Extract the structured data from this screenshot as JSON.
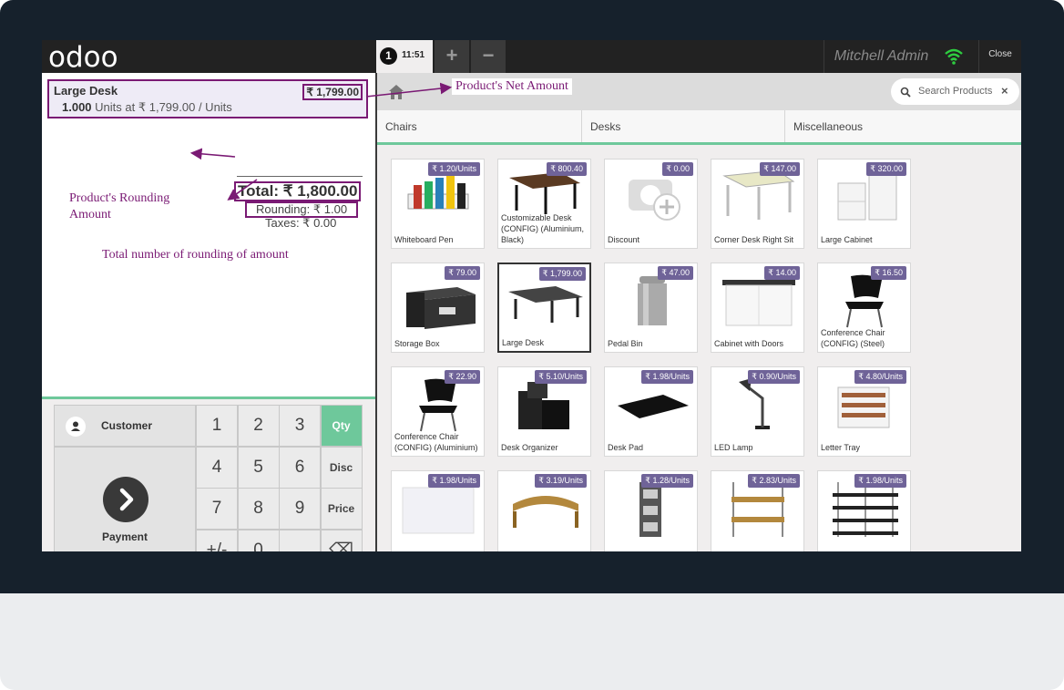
{
  "topbar": {
    "logo": "odoo",
    "order_number": "1",
    "order_time": "11:51",
    "add_label": "+",
    "remove_label": "−",
    "user": "Mitchell Admin",
    "close_label": "Close",
    "wifi_color": "#2ecc40"
  },
  "orderline": {
    "name": "Large Desk",
    "price": "₹ 1,799.00",
    "qty": "1.000",
    "unit_info": "Units at ₹ 1,799.00 / Units"
  },
  "summary": {
    "total": "Total: ₹ 1,800.00",
    "rounding": "Rounding: ₹ 1.00",
    "taxes": "Taxes: ₹ 0.00"
  },
  "annotations": {
    "rounding_line1": "Product's Rounding",
    "rounding_line2": "Amount",
    "total_rounding": "Total number of rounding of amount",
    "net_amount": "Product's Net Amount",
    "color": "#7a1a74"
  },
  "actionpad": {
    "customer": "Customer",
    "payment": "Payment"
  },
  "numpad": {
    "keys": [
      "1",
      "2",
      "3",
      "Qty",
      "4",
      "5",
      "6",
      "Disc",
      "7",
      "8",
      "9",
      "Price",
      "+/-",
      "0",
      ".",
      "⌫"
    ],
    "active_mode": "Qty",
    "accent": "#6ec89b"
  },
  "search": {
    "placeholder": "Search Products",
    "clear": "×"
  },
  "categories": [
    "Chairs",
    "Desks",
    "Miscellaneous"
  ],
  "products": [
    {
      "name": "Whiteboard Pen",
      "price": "₹ 1.20/Units",
      "icon": "markers"
    },
    {
      "name": "Customizable Desk (CONFIG) (Aluminium, Black)",
      "price": "₹ 800.40",
      "icon": "desk-brown"
    },
    {
      "name": "Discount",
      "price": "₹ 0.00",
      "icon": "camera-placeholder"
    },
    {
      "name": "Corner Desk Right Sit",
      "price": "₹ 147.00",
      "icon": "desk-light"
    },
    {
      "name": "Large Cabinet",
      "price": "₹ 320.00",
      "icon": "cabinet-white"
    },
    {
      "name": "Storage Box",
      "price": "₹ 79.00",
      "icon": "box-black"
    },
    {
      "name": "Large Desk",
      "price": "₹ 1,799.00",
      "icon": "desk-large",
      "selected": true
    },
    {
      "name": "Pedal Bin",
      "price": "₹ 47.00",
      "icon": "bin"
    },
    {
      "name": "Cabinet with Doors",
      "price": "₹ 14.00",
      "icon": "cabinet-doors"
    },
    {
      "name": "Conference Chair (CONFIG) (Steel)",
      "price": "₹ 16.50",
      "icon": "chair"
    },
    {
      "name": "Conference Chair (CONFIG) (Aluminium)",
      "price": "₹ 22.90",
      "icon": "chair"
    },
    {
      "name": "Desk Organizer",
      "price": "₹ 5.10/Units",
      "icon": "organizer"
    },
    {
      "name": "Desk Pad",
      "price": "₹ 1.98/Units",
      "icon": "pad"
    },
    {
      "name": "LED Lamp",
      "price": "₹ 0.90/Units",
      "icon": "lamp"
    },
    {
      "name": "Letter Tray",
      "price": "₹ 4.80/Units",
      "icon": "tray"
    },
    {
      "name": "",
      "price": "₹ 1.98/Units",
      "icon": "board"
    },
    {
      "name": "",
      "price": "₹ 3.19/Units",
      "icon": "stand"
    },
    {
      "name": "",
      "price": "₹ 1.28/Units",
      "icon": "rack"
    },
    {
      "name": "",
      "price": "₹ 2.83/Units",
      "icon": "shelf"
    },
    {
      "name": "",
      "price": "₹ 1.98/Units",
      "icon": "wall-shelf"
    }
  ]
}
